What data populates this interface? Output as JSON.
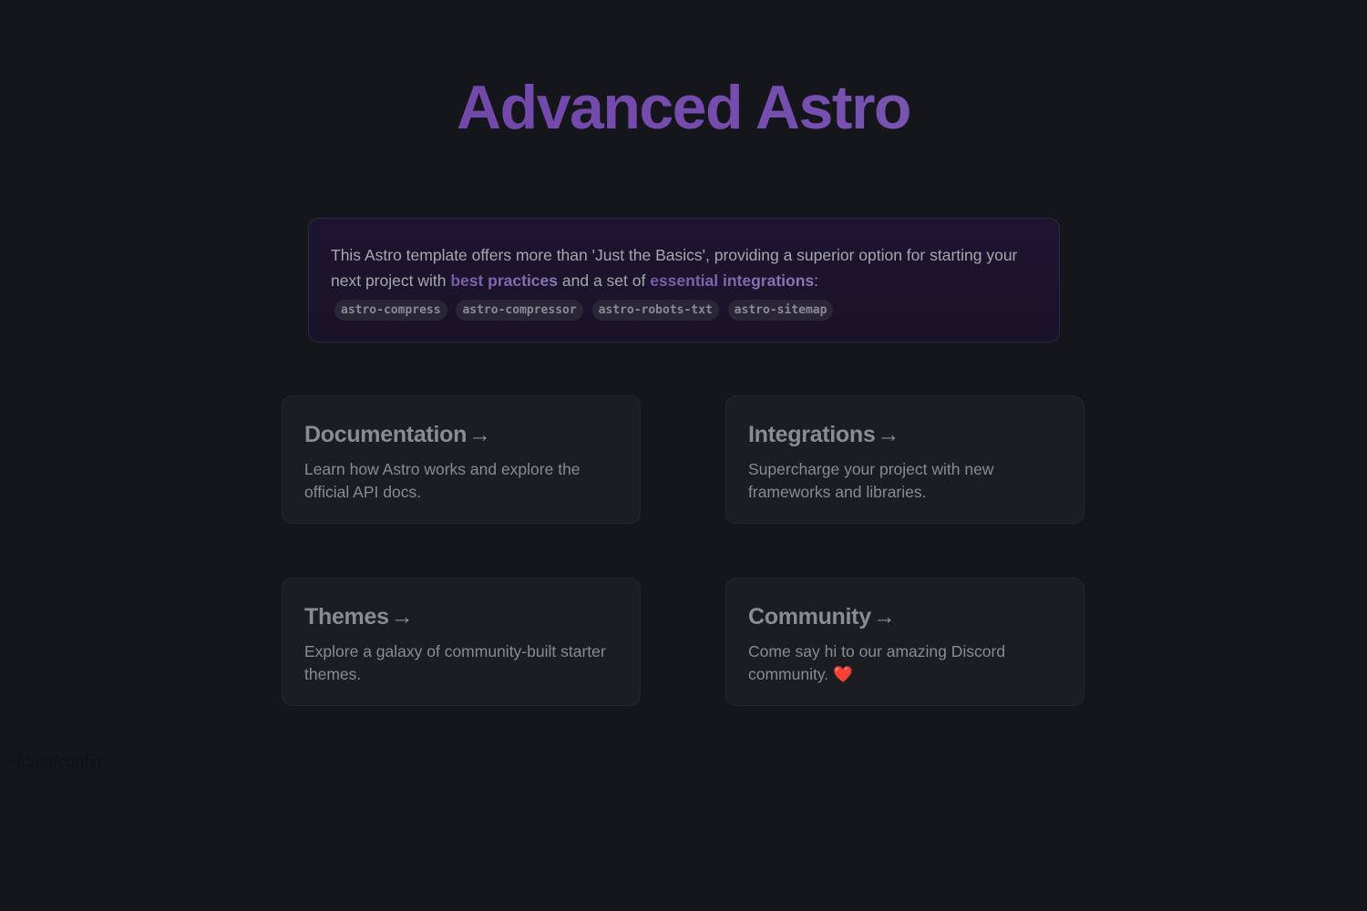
{
  "header": {
    "title": "Advanced Astro"
  },
  "instructions": {
    "text_before": "This Astro template offers more than 'Just the Basics', providing a superior option for starting your next project with ",
    "highlight_1": "best practices",
    "text_middle": " and a set of ",
    "highlight_2": "essential integrations",
    "text_after": ":",
    "tags": [
      "astro-compress",
      "astro-compressor",
      "astro-robots-txt",
      "astro-sitemap"
    ]
  },
  "cards": [
    {
      "title": "Documentation",
      "arrow": "→",
      "body": "Learn how Astro works and explore the official API docs."
    },
    {
      "title": "Integrations",
      "arrow": "→",
      "body": "Supercharge your project with new frameworks and libraries."
    },
    {
      "title": "Themes",
      "arrow": "→",
      "body": "Explore a galaxy of community-built starter themes."
    },
    {
      "title": "Community",
      "arrow": "→",
      "body": "Come say hi to our amazing Discord community. ",
      "emoji": "❤️"
    }
  ],
  "footer": {
    "path": "~/data/config"
  },
  "colors": {
    "background": "#15161b",
    "accent": "#774fb0",
    "card_background": "#1b1d22"
  }
}
